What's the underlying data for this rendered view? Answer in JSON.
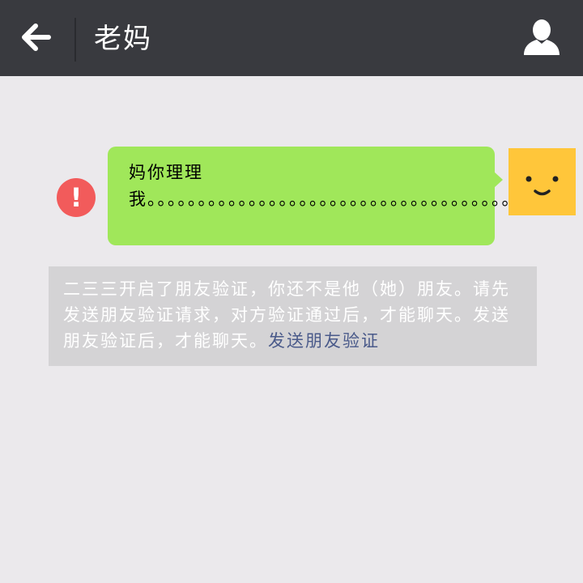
{
  "header": {
    "title": "老妈",
    "back_icon": "arrow-left-icon",
    "profile_icon": "person-icon"
  },
  "message": {
    "text": "妈你理理我。。。。。。。。。。。。。。。。。。。。。。。。。。。。。。。。。。。。。。",
    "status_icon": "error-icon",
    "status_glyph": "!",
    "bubble_color": "#a0e75a"
  },
  "avatar": {
    "icon": "smiley-face-icon",
    "color": "#ffc63a"
  },
  "system_notice": {
    "text": "二三三开启了朋友验证，你还不是他（她）朋友。请先发送朋友验证请求，对方验证通过后，才能聊天。发送朋友验证后，才能聊天。",
    "link_text": "发送朋友验证"
  },
  "colors": {
    "topbar": "#393a3f",
    "background": "#ebe9ec",
    "error": "#f25b5b",
    "link": "#4a5a8a"
  }
}
